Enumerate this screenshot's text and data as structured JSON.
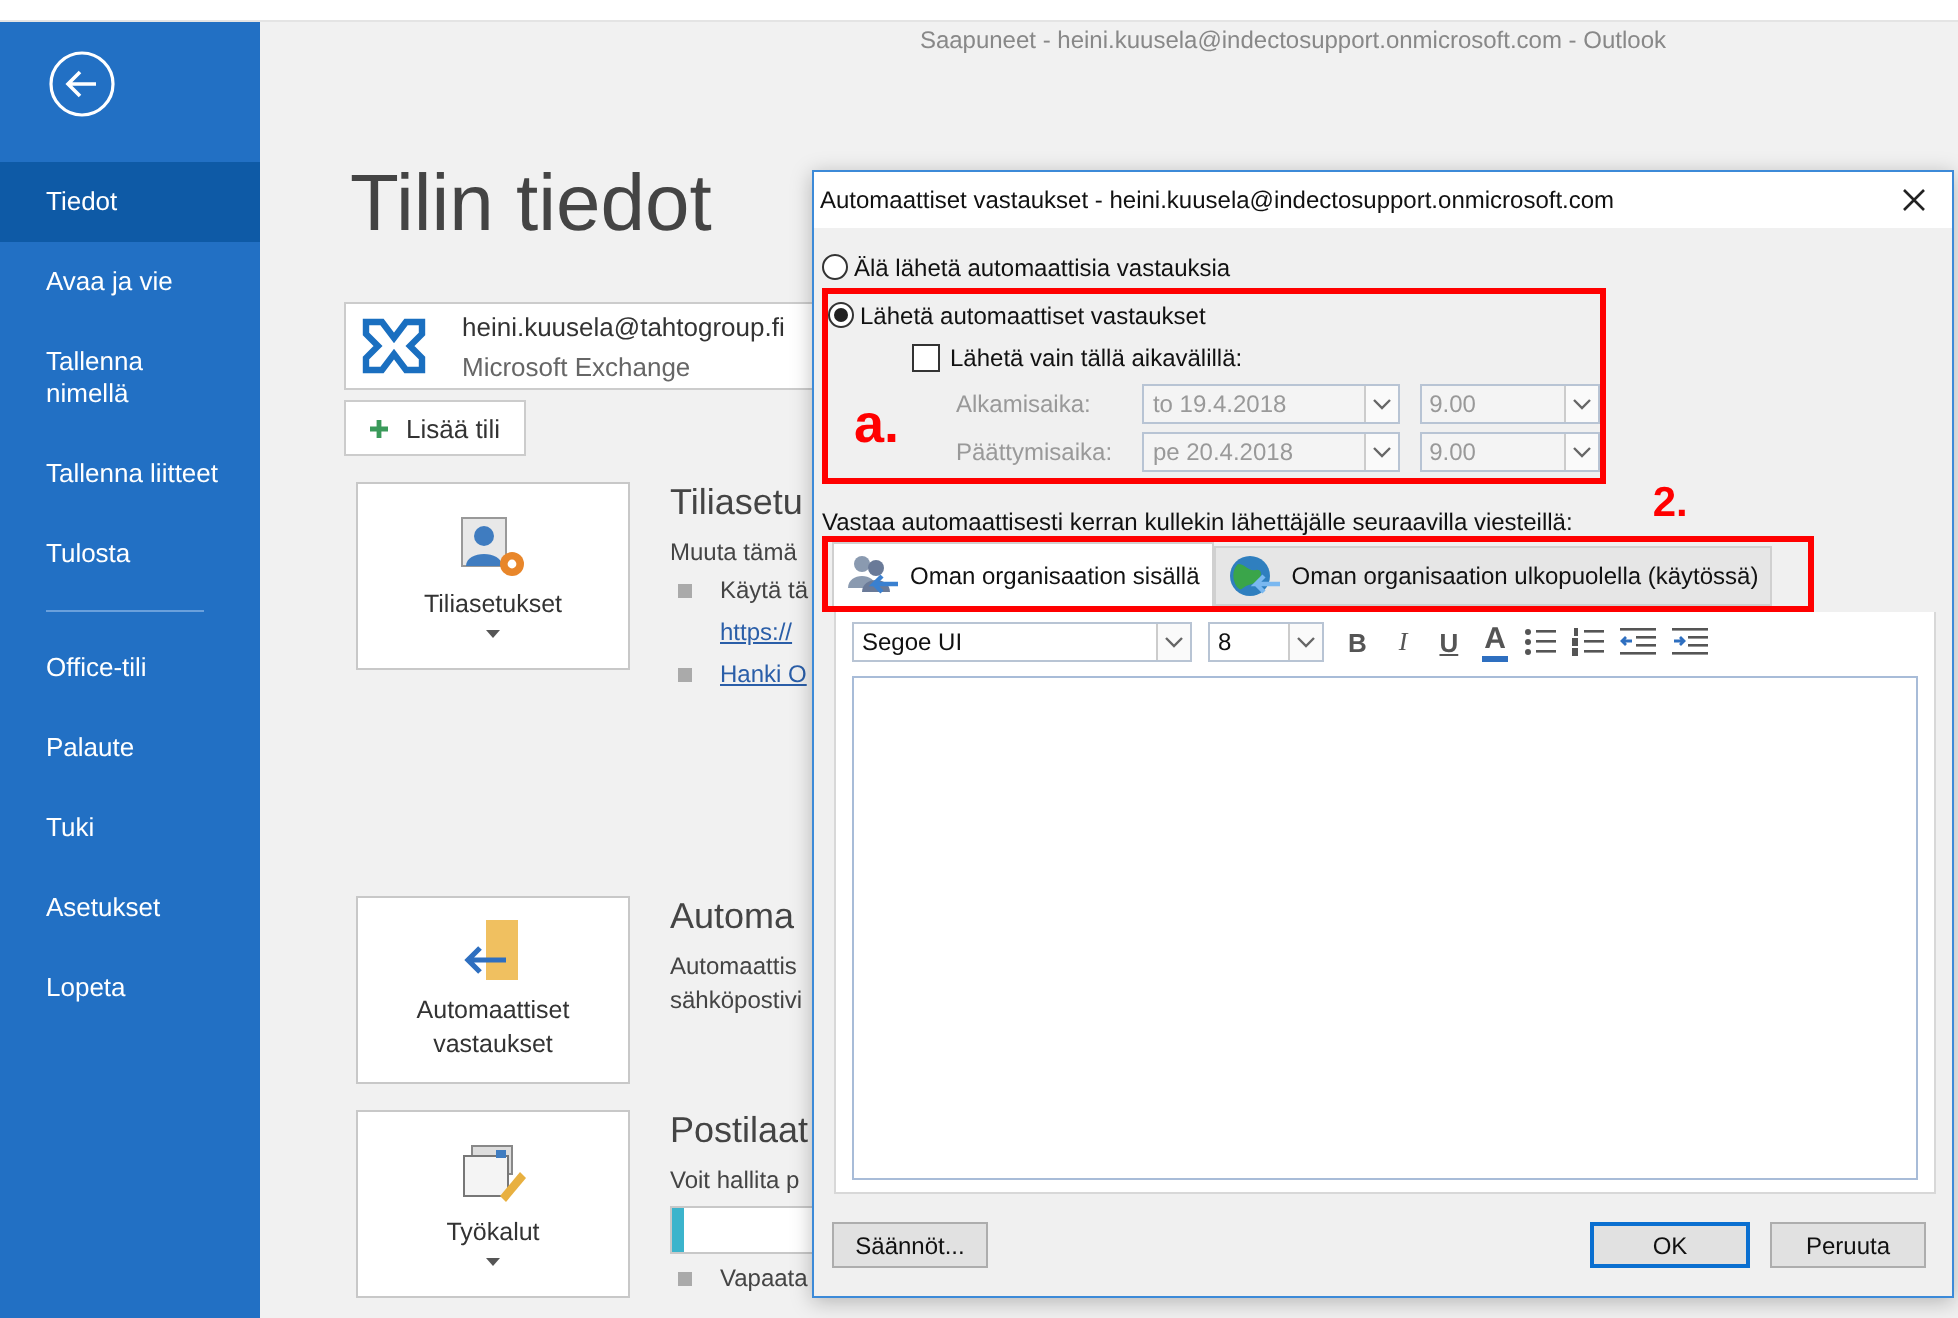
{
  "window": {
    "title": "Saapuneet - heini.kuusela@indectosupport.onmicrosoft.com  -  Outlook"
  },
  "sidebar": {
    "items": [
      {
        "label": "Tiedot",
        "selected": true
      },
      {
        "label": "Avaa ja vie",
        "selected": false
      },
      {
        "label": "Tallenna nimellä",
        "selected": false
      },
      {
        "label": "Tallenna liitteet",
        "selected": false
      },
      {
        "label": "Tulosta",
        "selected": false
      },
      {
        "label": "Office-tili",
        "selected": false,
        "divider_before": true
      },
      {
        "label": "Palaute",
        "selected": false
      },
      {
        "label": "Tuki",
        "selected": false
      },
      {
        "label": "Asetukset",
        "selected": false
      },
      {
        "label": "Lopeta",
        "selected": false
      }
    ]
  },
  "page": {
    "heading": "Tilin tiedot",
    "account": {
      "email": "heini.kuusela@tahtogroup.fi",
      "type": "Microsoft Exchange"
    },
    "add_button": "Lisää tili",
    "sections": [
      {
        "tile": "Tiliasetukset",
        "dropdown": true,
        "heading": "Tiliasetu",
        "lines": [
          {
            "kind": "text",
            "text": "Muuta tämä"
          },
          {
            "kind": "bullet",
            "text": "Käytä tä"
          },
          {
            "kind": "link",
            "text": "https://"
          },
          {
            "kind": "bullet-link",
            "text": "Hanki O"
          }
        ]
      },
      {
        "tile": "Automaattiset vastaukset",
        "dropdown": false,
        "heading": "Automa",
        "lines": [
          {
            "kind": "text",
            "text": "Automaattis"
          },
          {
            "kind": "text",
            "text": "sähköpostivi"
          }
        ]
      },
      {
        "tile": "Työkalut",
        "dropdown": true,
        "heading": "Postilaat",
        "lines": [
          {
            "kind": "text",
            "text": "Voit hallita p"
          },
          {
            "kind": "meter",
            "level": 0.02
          },
          {
            "kind": "bullet",
            "text": "Vapaata"
          }
        ]
      }
    ]
  },
  "dialog": {
    "title": "Automaattiset vastaukset - heini.kuusela@indectosupport.onmicrosoft.com",
    "options": [
      {
        "label": "Älä lähetä automaattisia vastauksia",
        "selected": false
      },
      {
        "label": "Lähetä automaattiset vastaukset",
        "selected": true
      }
    ],
    "time_range": {
      "label": "Lähetä vain tällä aikavälillä:",
      "checked": false,
      "rows": [
        {
          "label": "Alkamisaika:",
          "date": "to 19.4.2018",
          "time": "9.00"
        },
        {
          "label": "Päättymisaika:",
          "date": "pe 20.4.2018",
          "time": "9.00"
        }
      ]
    },
    "annotations": {
      "a": "a.",
      "b": "2."
    },
    "reply_label": "Vastaa automaattisesti kerran kullekin lähettäjälle seuraavilla viesteillä:",
    "tabs": [
      {
        "label": "Oman organisaation sisällä",
        "selected": true
      },
      {
        "label": "Oman organisaation ulkopuolella (käytössä)",
        "selected": false
      }
    ],
    "toolbar": {
      "font": "Segoe UI",
      "size": "8",
      "format": [
        "B",
        "I",
        "U",
        "A"
      ]
    },
    "buttons": {
      "rules": "Säännöt...",
      "ok": "OK",
      "cancel": "Peruuta"
    }
  }
}
